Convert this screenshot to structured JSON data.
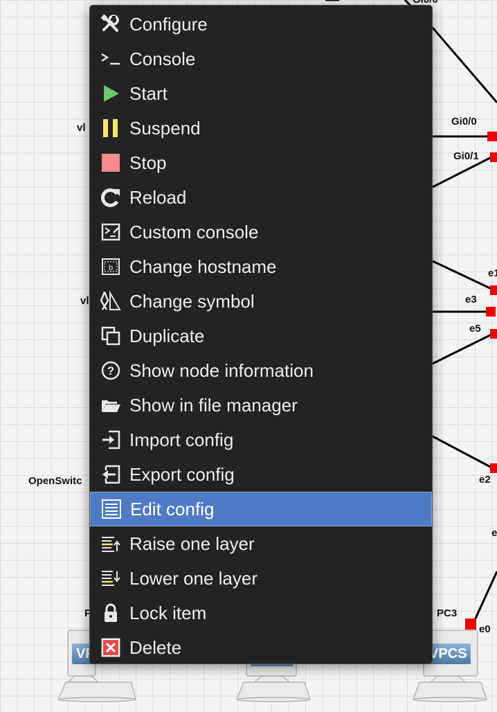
{
  "canvas": {
    "labels": {
      "gi0_0_top": "Gi0/0",
      "gi0_0": "Gi0/0",
      "gi0_1": "Gi0/1",
      "vl_upper": "vl",
      "vl_lower": "vl",
      "e1": "e1",
      "e3": "e3",
      "e5": "e5",
      "e2": "e2",
      "e_right": "e",
      "openswitch": "OpenSwitc",
      "p_left": "P",
      "pc3": "PC3",
      "e0": "e0"
    },
    "vpcs": {
      "left": "VP",
      "right": "VPCS"
    }
  },
  "menu": {
    "items": [
      {
        "label": "Configure",
        "icon": "wrench-screwdriver-icon"
      },
      {
        "label": "Console",
        "icon": "terminal-prompt-icon"
      },
      {
        "label": "Start",
        "icon": "play-icon"
      },
      {
        "label": "Suspend",
        "icon": "pause-icon"
      },
      {
        "label": "Stop",
        "icon": "stop-icon"
      },
      {
        "label": "Reload",
        "icon": "reload-icon"
      },
      {
        "label": "Custom console",
        "icon": "custom-console-icon"
      },
      {
        "label": "Change hostname",
        "icon": "hostname-tag-icon"
      },
      {
        "label": "Change symbol",
        "icon": "drafting-tools-icon"
      },
      {
        "label": "Duplicate",
        "icon": "duplicate-icon"
      },
      {
        "label": "Show node information",
        "icon": "question-circle-icon"
      },
      {
        "label": "Show in file manager",
        "icon": "open-folder-icon"
      },
      {
        "label": "Import config",
        "icon": "import-icon"
      },
      {
        "label": "Export config",
        "icon": "export-icon"
      },
      {
        "label": "Edit config",
        "icon": "edit-list-icon",
        "selected": true
      },
      {
        "label": "Raise one layer",
        "icon": "raise-layer-icon"
      },
      {
        "label": "Lower one layer",
        "icon": "lower-layer-icon"
      },
      {
        "label": "Lock item",
        "icon": "padlock-icon"
      },
      {
        "label": "Delete",
        "icon": "delete-x-icon"
      }
    ],
    "colors": {
      "background": "#232323",
      "selected": "#4f7bc4",
      "start": "#6cc86c",
      "suspend": "#f4e66a",
      "stop": "#f28b8b",
      "delete": "#e84848"
    }
  }
}
